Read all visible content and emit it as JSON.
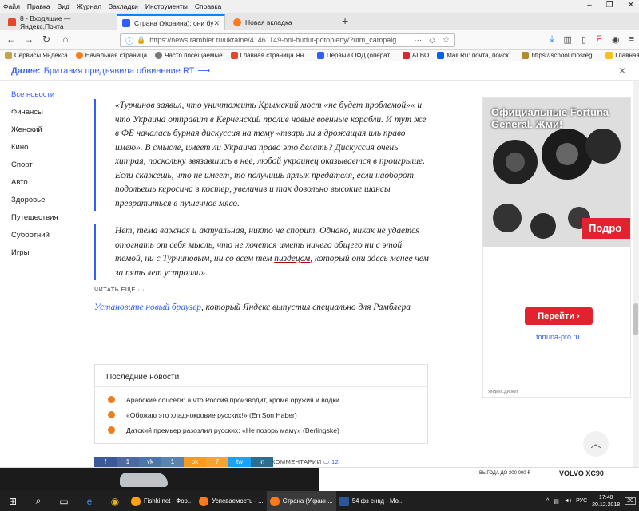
{
  "browser": {
    "menu": [
      "Файл",
      "Правка",
      "Вид",
      "Журнал",
      "Закладки",
      "Инструменты",
      "Справка"
    ],
    "tabs": [
      {
        "title": "8 - Входящие — Яндекс.Почта",
        "color": "#e8462a"
      },
      {
        "title": "Страна (Украина): они будут п",
        "color": "#315efb"
      },
      {
        "title": "Новая вкладка",
        "color": "#ff7a1a"
      }
    ],
    "url": "https://news.rambler.ru/ukraine/41461149-oni-budut-potopleny/?utm_campaig",
    "bookmarks": [
      {
        "label": "Сервисы Яндекса",
        "color": "#c8102e"
      },
      {
        "label": "Начальная страница",
        "color": "#ff7a1a"
      },
      {
        "label": "Часто посещаемые",
        "color": "#555555"
      },
      {
        "label": "Главная страница Ян...",
        "color": "#e8462a"
      },
      {
        "label": "Первый ОФД (операт...",
        "color": "#315efb"
      },
      {
        "label": "ALBO",
        "color": "#e2232f"
      },
      {
        "label": "Mail.Ru: почта, поиск...",
        "color": "#005ff9"
      },
      {
        "label": "https://school.mosreg...",
        "color": "#b08a2e"
      },
      {
        "label": "Главная",
        "color": "#f0c419"
      }
    ]
  },
  "nextbar": {
    "label": "Далее:",
    "title": "Британия предъявила обвинение RT",
    "arrow": "⟶"
  },
  "leftnav": [
    "Все новости",
    "Финансы",
    "Женский",
    "Кино",
    "Спорт",
    "Авто",
    "Здоровье",
    "Путешествия",
    "Субботний",
    "Игры"
  ],
  "article": {
    "quote1": "«Турчинов заявил, что уничтожить Крымский мост «не будет проблемой»« и что Украина отправит в Керченский пролив новые военные корабли. И тут же в ФБ началась бурная дискуссия на тему «тварь ли я дрожащая иль право имею». В смысле, имеет ли Украина право это делать? Дискуссия очень хитрая, поскольку ввязавшись в нее, любой украинец оказывается в проигрыше. Если скажешь, что не имеет, то получишь ярлык предателя, если наоборот — подольешь керосина в костер, увеличив и так довольно высокие шансы превратиться в пушечное мясо.",
    "quote2_a": "Нет, тема важная и актуальная, никто не спорит. Однако, никак не удается отогнать от себя мысль, что не хочется иметь ничего общего ни с этой темой, ни с Турчиновым, ни со всем тем ",
    "quote2_u": "пиздецом",
    "quote2_b": ", который они здесь менее чем за пять лет устроили».",
    "readmore": "ЧИТАТЬ ЕЩЁ  ···",
    "browser_link": "Установите новый браузер",
    "browser_text": ", который Яндекс выпустил специально для Рамблера"
  },
  "news": {
    "header": "Последние новости",
    "items": [
      "Арабские соцсети: а что Россия производит, кроме оружия и водки",
      "«Обожаю это хладнокровие русских!» (En Son Haber)",
      "Датский премьер разозлил русских: «Не позорь маму» (Berlingske)"
    ]
  },
  "share": [
    {
      "label": "f",
      "color": "#3b5998"
    },
    {
      "label": "1",
      "color": "#3b5998"
    },
    {
      "label": "vk",
      "color": "#4a76a8"
    },
    {
      "label": "1",
      "color": "#4a76a8"
    },
    {
      "label": "ok",
      "color": "#f59a23"
    },
    {
      "label": "7",
      "color": "#f59a23"
    },
    {
      "label": "tw",
      "color": "#1da1f2"
    },
    {
      "label": "in",
      "color": "#2b6e8f"
    }
  ],
  "comments": {
    "label": "КОММЕНТАРИИ",
    "count": "12"
  },
  "ad": {
    "brand": "Официальные Fortuna General. Жми!",
    "red": "Подро",
    "button": "Перейти ›",
    "domain": "fortuna-pro.ru",
    "yd": "Яндекс.Директ"
  },
  "banner": {
    "promo": "ВЫГОДА ДО 300 000 ₽",
    "model": "VOLVO XC90"
  },
  "taskbar": {
    "items": [
      {
        "label": "Fishki.net - Фор...",
        "color": "#ff9f1a"
      },
      {
        "label": "Успеваемость - ...",
        "color": "#ff7a1a"
      },
      {
        "label": "Страна (Украин...",
        "color": "#ff7a1a"
      },
      {
        "label": "54 фз енвд - Мо...",
        "color": "#2b5797"
      }
    ],
    "lang": "РУС",
    "time": "17:48",
    "date": "20.12.2018",
    "badge": "20"
  }
}
